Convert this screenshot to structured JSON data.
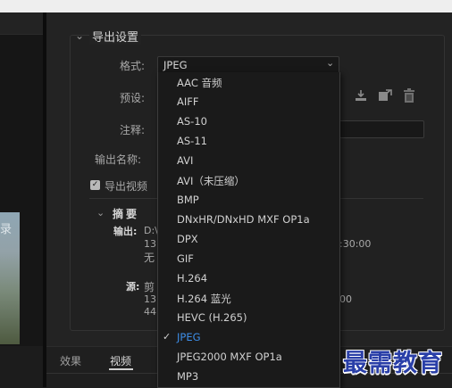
{
  "left": {
    "thumb_text": "录"
  },
  "section": {
    "title": "导出设置"
  },
  "form": {
    "format_label": "格式:",
    "format_value": "JPEG",
    "preset_label": "预设:",
    "comment_label": "注释:",
    "output_name_label": "输出名称:",
    "export_video_label": "导出视频"
  },
  "summary": {
    "title": "摘要",
    "output_label": "输出:",
    "output_line1": "D:\\",
    "output_line2": "13",
    "output_line2_right": ":30:00",
    "output_line3": "无",
    "source_label": "源:",
    "source_line1": "剪",
    "source_line2": "13",
    "source_line2_right": "00",
    "source_line3": "44"
  },
  "tabs": [
    {
      "label": "效果"
    },
    {
      "label": "视频"
    }
  ],
  "dropdown": {
    "items": [
      "AAC 音频",
      "AIFF",
      "AS-10",
      "AS-11",
      "AVI",
      "AVI（未压缩）",
      "BMP",
      "DNxHR/DNxHD MXF OP1a",
      "DPX",
      "GIF",
      "H.264",
      "H.264 蓝光",
      "HEVC (H.265)",
      "JPEG",
      "JPEG2000 MXF OP1a",
      "MP3"
    ],
    "selected": "JPEG",
    "check_glyph": "✓"
  },
  "icons": {
    "chevron_down": "⌄",
    "chevron_right": "˅"
  },
  "watermark": {
    "text": "最需教育"
  },
  "colors": {
    "accent": "#3d8ee8",
    "watermark": "#2a3fa8",
    "panel_bg": "#232323",
    "dropdown_bg": "#1a1a1a"
  }
}
